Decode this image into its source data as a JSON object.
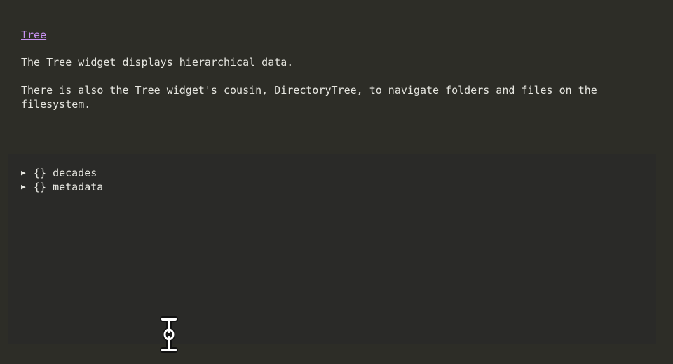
{
  "header": {
    "title_link": "Tree"
  },
  "body": {
    "paragraph_1": "The Tree widget displays hierarchical data.",
    "paragraph_2": "There is also the Tree widget's cousin, DirectoryTree, to navigate folders and files on the filesystem."
  },
  "tree": {
    "nodes": [
      {
        "arrow": "▶",
        "icon": "{}",
        "label": "decades",
        "expanded": false
      },
      {
        "arrow": "▶",
        "icon": "{}",
        "label": "metadata",
        "expanded": false
      }
    ]
  },
  "icons": {
    "expand_arrow": "triangle-right-icon",
    "object_braces": "braces-icon",
    "mouse_cursor": "text-cursor-icon"
  },
  "colors": {
    "background": "#2d2d27",
    "panel": "#2a2a28",
    "text": "#e6e6e0",
    "link": "#c892f2"
  }
}
